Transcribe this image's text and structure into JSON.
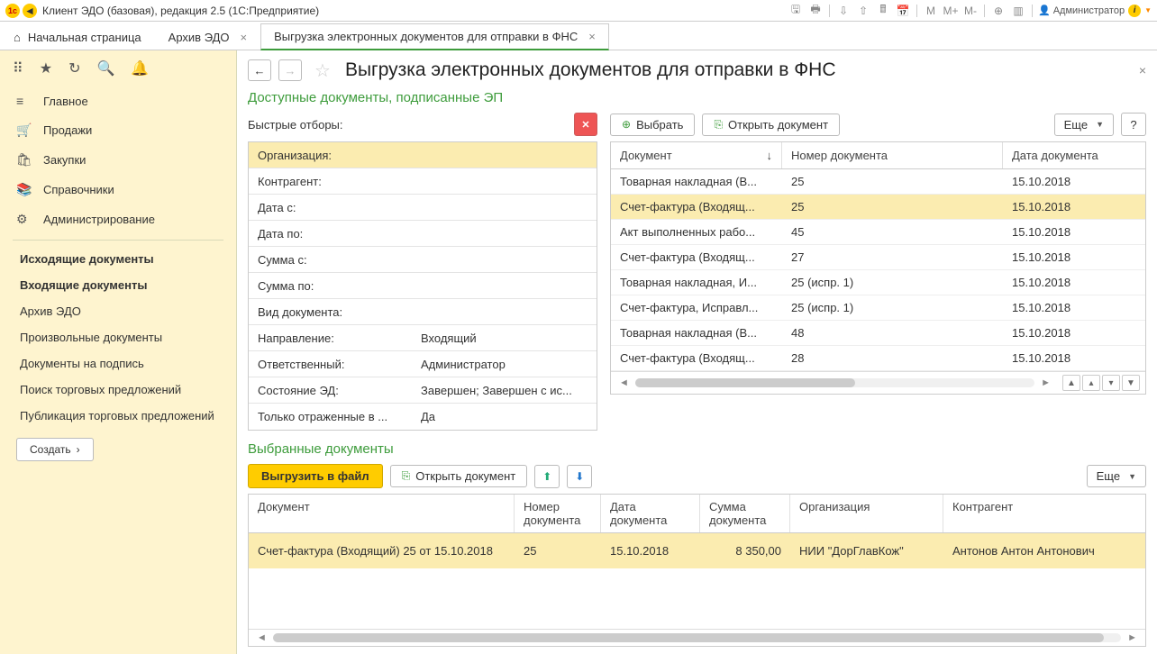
{
  "titlebar": {
    "title": "Клиент ЭДО (базовая), редакция 2.5  (1С:Предприятие)",
    "user": "Администратор",
    "m": "M",
    "mplus": "M+",
    "mminus": "M-"
  },
  "tabs": {
    "home": "Начальная страница",
    "archive": "Архив ЭДО",
    "export": "Выгрузка электронных документов для отправки в ФНС"
  },
  "sidebar": {
    "main": "Главное",
    "sales": "Продажи",
    "purchases": "Закупки",
    "refs": "Справочники",
    "admin": "Администрирование",
    "outgoing": "Исходящие документы",
    "incoming": "Входящие документы",
    "archive": "Архив ЭДО",
    "arbitrary": "Произвольные документы",
    "tosign": "Документы на подпись",
    "tradesearch": "Поиск торговых предложений",
    "tradepub": "Публикация торговых предложений",
    "create": "Создать"
  },
  "page": {
    "title": "Выгрузка электронных документов для отправки в ФНС"
  },
  "available": {
    "title": "Доступные документы, подписанные ЭП",
    "fast_filters": "Быстрые отборы:",
    "filters": [
      {
        "label": "Организация:",
        "value": ""
      },
      {
        "label": "Контрагент:",
        "value": ""
      },
      {
        "label": "Дата с:",
        "value": ""
      },
      {
        "label": "Дата по:",
        "value": ""
      },
      {
        "label": "Сумма с:",
        "value": ""
      },
      {
        "label": "Сумма по:",
        "value": ""
      },
      {
        "label": "Вид документа:",
        "value": ""
      },
      {
        "label": "Направление:",
        "value": "Входящий"
      },
      {
        "label": "Ответственный:",
        "value": "Администратор"
      },
      {
        "label": "Состояние ЭД:",
        "value": "Завершен; Завершен с ис..."
      },
      {
        "label": "Только отраженные в ...",
        "value": "Да"
      }
    ],
    "toolbar": {
      "select": "Выбрать",
      "open": "Открыть документ",
      "more": "Еще",
      "help": "?"
    },
    "columns": {
      "doc": "Документ",
      "num": "Номер документа",
      "date": "Дата документа"
    },
    "rows": [
      {
        "doc": "Товарная накладная (В...",
        "num": "25",
        "date": "15.10.2018"
      },
      {
        "doc": "Счет-фактура (Входящ...",
        "num": "25",
        "date": "15.10.2018",
        "selected": true
      },
      {
        "doc": "Акт выполненных рабо...",
        "num": "45",
        "date": "15.10.2018"
      },
      {
        "doc": "Счет-фактура (Входящ...",
        "num": "27",
        "date": "15.10.2018"
      },
      {
        "doc": "Товарная накладная, И...",
        "num": "25 (испр. 1)",
        "date": "15.10.2018"
      },
      {
        "doc": "Счет-фактура, Исправл...",
        "num": "25 (испр. 1)",
        "date": "15.10.2018"
      },
      {
        "doc": "Товарная накладная (В...",
        "num": "48",
        "date": "15.10.2018"
      },
      {
        "doc": "Счет-фактура (Входящ...",
        "num": "28",
        "date": "15.10.2018"
      }
    ]
  },
  "selected": {
    "title": "Выбранные документы",
    "toolbar": {
      "export": "Выгрузить в файл",
      "open": "Открыть документ",
      "more": "Еще"
    },
    "columns": {
      "doc": "Документ",
      "num": "Номер документа",
      "date": "Дата документа",
      "sum": "Сумма документа",
      "org": "Организация",
      "contr": "Контрагент"
    },
    "rows": [
      {
        "doc": "Счет-фактура (Входящий) 25 от 15.10.2018",
        "num": "25",
        "date": "15.10.2018",
        "sum": "8 350,00",
        "org": "НИИ \"ДорГлавКож\"",
        "contr": "Антонов Антон Антонович"
      }
    ]
  }
}
